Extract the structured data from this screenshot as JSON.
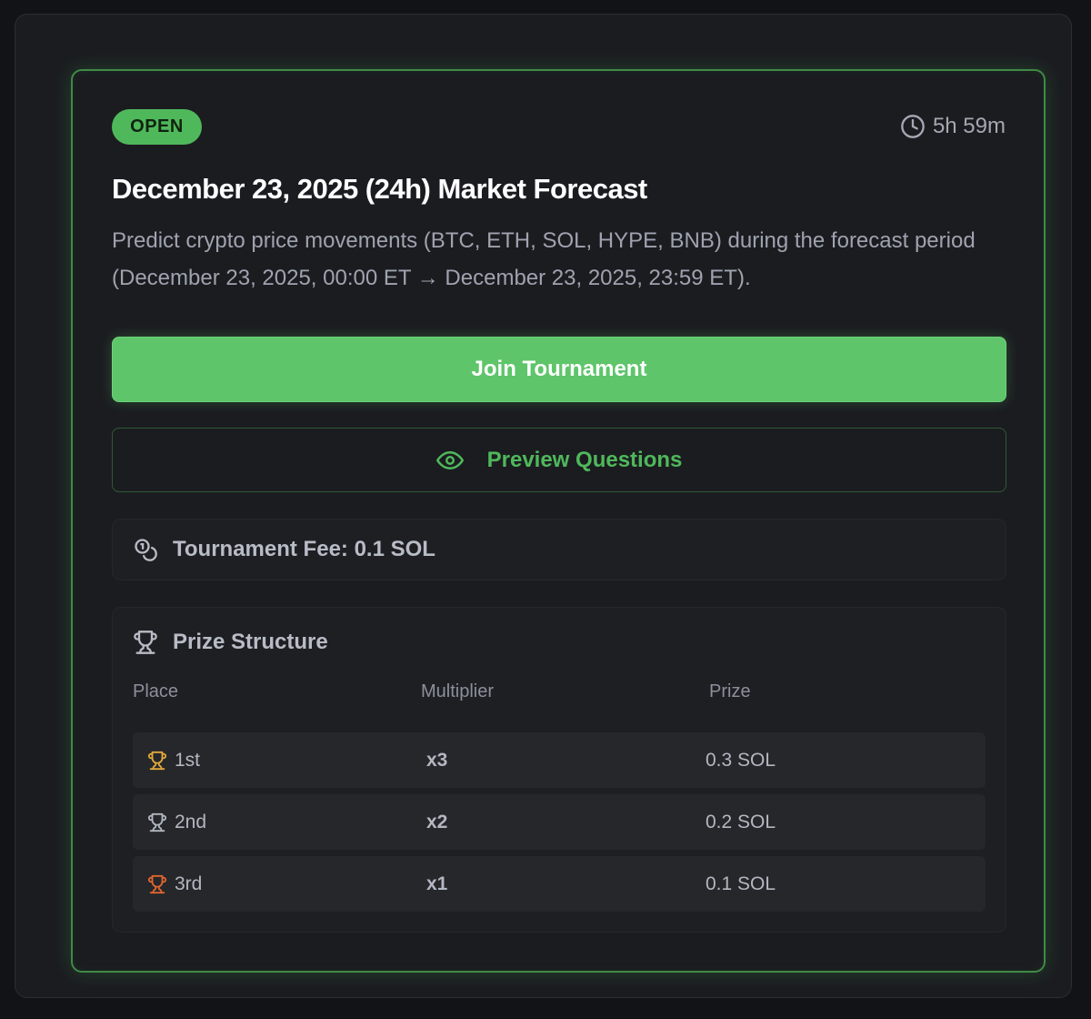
{
  "status_badge": "OPEN",
  "timer": {
    "icon": "clock-icon",
    "text": "5h 59m"
  },
  "title": "December 23, 2025 (24h) Market Forecast",
  "description": "Predict crypto price movements (BTC, ETH, SOL, HYPE, BNB) during the forecast period (December 23, 2025, 00:00 ET → December 23, 2025, 23:59 ET).",
  "actions": {
    "join_label": "Join Tournament",
    "preview_label": "Preview Questions",
    "preview_icon": "eye-icon"
  },
  "fee": {
    "icon": "coins-icon",
    "text": "Tournament Fee: 0.1 SOL"
  },
  "prize_structure": {
    "icon": "trophy-icon",
    "title": "Prize Structure",
    "columns": [
      "Place",
      "Multiplier",
      "Prize"
    ],
    "rows": [
      {
        "place": "1st",
        "multiplier": "x3",
        "prize": "0.3 SOL",
        "trophy_color": "#e3a93a"
      },
      {
        "place": "2nd",
        "multiplier": "x2",
        "prize": "0.2 SOL",
        "trophy_color": "#b3b7c1"
      },
      {
        "place": "3rd",
        "multiplier": "x1",
        "prize": "0.1 SOL",
        "trophy_color": "#e0662e"
      }
    ]
  },
  "colors": {
    "accent": "#5ec56a",
    "accent_dark": "#4fb85b",
    "background": "#121316",
    "card": "#1b1c20"
  }
}
